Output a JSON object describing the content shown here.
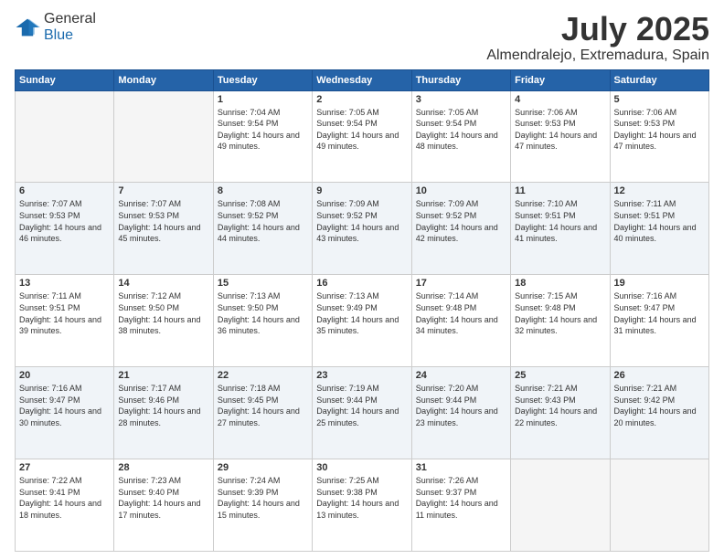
{
  "header": {
    "logo_general": "General",
    "logo_blue": "Blue",
    "month": "July 2025",
    "location": "Almendralejo, Extremadura, Spain"
  },
  "weekdays": [
    "Sunday",
    "Monday",
    "Tuesday",
    "Wednesday",
    "Thursday",
    "Friday",
    "Saturday"
  ],
  "weeks": [
    [
      {
        "day": "",
        "sunrise": "",
        "sunset": "",
        "daylight": ""
      },
      {
        "day": "",
        "sunrise": "",
        "sunset": "",
        "daylight": ""
      },
      {
        "day": "1",
        "sunrise": "Sunrise: 7:04 AM",
        "sunset": "Sunset: 9:54 PM",
        "daylight": "Daylight: 14 hours and 49 minutes."
      },
      {
        "day": "2",
        "sunrise": "Sunrise: 7:05 AM",
        "sunset": "Sunset: 9:54 PM",
        "daylight": "Daylight: 14 hours and 49 minutes."
      },
      {
        "day": "3",
        "sunrise": "Sunrise: 7:05 AM",
        "sunset": "Sunset: 9:54 PM",
        "daylight": "Daylight: 14 hours and 48 minutes."
      },
      {
        "day": "4",
        "sunrise": "Sunrise: 7:06 AM",
        "sunset": "Sunset: 9:53 PM",
        "daylight": "Daylight: 14 hours and 47 minutes."
      },
      {
        "day": "5",
        "sunrise": "Sunrise: 7:06 AM",
        "sunset": "Sunset: 9:53 PM",
        "daylight": "Daylight: 14 hours and 47 minutes."
      }
    ],
    [
      {
        "day": "6",
        "sunrise": "Sunrise: 7:07 AM",
        "sunset": "Sunset: 9:53 PM",
        "daylight": "Daylight: 14 hours and 46 minutes."
      },
      {
        "day": "7",
        "sunrise": "Sunrise: 7:07 AM",
        "sunset": "Sunset: 9:53 PM",
        "daylight": "Daylight: 14 hours and 45 minutes."
      },
      {
        "day": "8",
        "sunrise": "Sunrise: 7:08 AM",
        "sunset": "Sunset: 9:52 PM",
        "daylight": "Daylight: 14 hours and 44 minutes."
      },
      {
        "day": "9",
        "sunrise": "Sunrise: 7:09 AM",
        "sunset": "Sunset: 9:52 PM",
        "daylight": "Daylight: 14 hours and 43 minutes."
      },
      {
        "day": "10",
        "sunrise": "Sunrise: 7:09 AM",
        "sunset": "Sunset: 9:52 PM",
        "daylight": "Daylight: 14 hours and 42 minutes."
      },
      {
        "day": "11",
        "sunrise": "Sunrise: 7:10 AM",
        "sunset": "Sunset: 9:51 PM",
        "daylight": "Daylight: 14 hours and 41 minutes."
      },
      {
        "day": "12",
        "sunrise": "Sunrise: 7:11 AM",
        "sunset": "Sunset: 9:51 PM",
        "daylight": "Daylight: 14 hours and 40 minutes."
      }
    ],
    [
      {
        "day": "13",
        "sunrise": "Sunrise: 7:11 AM",
        "sunset": "Sunset: 9:51 PM",
        "daylight": "Daylight: 14 hours and 39 minutes."
      },
      {
        "day": "14",
        "sunrise": "Sunrise: 7:12 AM",
        "sunset": "Sunset: 9:50 PM",
        "daylight": "Daylight: 14 hours and 38 minutes."
      },
      {
        "day": "15",
        "sunrise": "Sunrise: 7:13 AM",
        "sunset": "Sunset: 9:50 PM",
        "daylight": "Daylight: 14 hours and 36 minutes."
      },
      {
        "day": "16",
        "sunrise": "Sunrise: 7:13 AM",
        "sunset": "Sunset: 9:49 PM",
        "daylight": "Daylight: 14 hours and 35 minutes."
      },
      {
        "day": "17",
        "sunrise": "Sunrise: 7:14 AM",
        "sunset": "Sunset: 9:48 PM",
        "daylight": "Daylight: 14 hours and 34 minutes."
      },
      {
        "day": "18",
        "sunrise": "Sunrise: 7:15 AM",
        "sunset": "Sunset: 9:48 PM",
        "daylight": "Daylight: 14 hours and 32 minutes."
      },
      {
        "day": "19",
        "sunrise": "Sunrise: 7:16 AM",
        "sunset": "Sunset: 9:47 PM",
        "daylight": "Daylight: 14 hours and 31 minutes."
      }
    ],
    [
      {
        "day": "20",
        "sunrise": "Sunrise: 7:16 AM",
        "sunset": "Sunset: 9:47 PM",
        "daylight": "Daylight: 14 hours and 30 minutes."
      },
      {
        "day": "21",
        "sunrise": "Sunrise: 7:17 AM",
        "sunset": "Sunset: 9:46 PM",
        "daylight": "Daylight: 14 hours and 28 minutes."
      },
      {
        "day": "22",
        "sunrise": "Sunrise: 7:18 AM",
        "sunset": "Sunset: 9:45 PM",
        "daylight": "Daylight: 14 hours and 27 minutes."
      },
      {
        "day": "23",
        "sunrise": "Sunrise: 7:19 AM",
        "sunset": "Sunset: 9:44 PM",
        "daylight": "Daylight: 14 hours and 25 minutes."
      },
      {
        "day": "24",
        "sunrise": "Sunrise: 7:20 AM",
        "sunset": "Sunset: 9:44 PM",
        "daylight": "Daylight: 14 hours and 23 minutes."
      },
      {
        "day": "25",
        "sunrise": "Sunrise: 7:21 AM",
        "sunset": "Sunset: 9:43 PM",
        "daylight": "Daylight: 14 hours and 22 minutes."
      },
      {
        "day": "26",
        "sunrise": "Sunrise: 7:21 AM",
        "sunset": "Sunset: 9:42 PM",
        "daylight": "Daylight: 14 hours and 20 minutes."
      }
    ],
    [
      {
        "day": "27",
        "sunrise": "Sunrise: 7:22 AM",
        "sunset": "Sunset: 9:41 PM",
        "daylight": "Daylight: 14 hours and 18 minutes."
      },
      {
        "day": "28",
        "sunrise": "Sunrise: 7:23 AM",
        "sunset": "Sunset: 9:40 PM",
        "daylight": "Daylight: 14 hours and 17 minutes."
      },
      {
        "day": "29",
        "sunrise": "Sunrise: 7:24 AM",
        "sunset": "Sunset: 9:39 PM",
        "daylight": "Daylight: 14 hours and 15 minutes."
      },
      {
        "day": "30",
        "sunrise": "Sunrise: 7:25 AM",
        "sunset": "Sunset: 9:38 PM",
        "daylight": "Daylight: 14 hours and 13 minutes."
      },
      {
        "day": "31",
        "sunrise": "Sunrise: 7:26 AM",
        "sunset": "Sunset: 9:37 PM",
        "daylight": "Daylight: 14 hours and 11 minutes."
      },
      {
        "day": "",
        "sunrise": "",
        "sunset": "",
        "daylight": ""
      },
      {
        "day": "",
        "sunrise": "",
        "sunset": "",
        "daylight": ""
      }
    ]
  ]
}
